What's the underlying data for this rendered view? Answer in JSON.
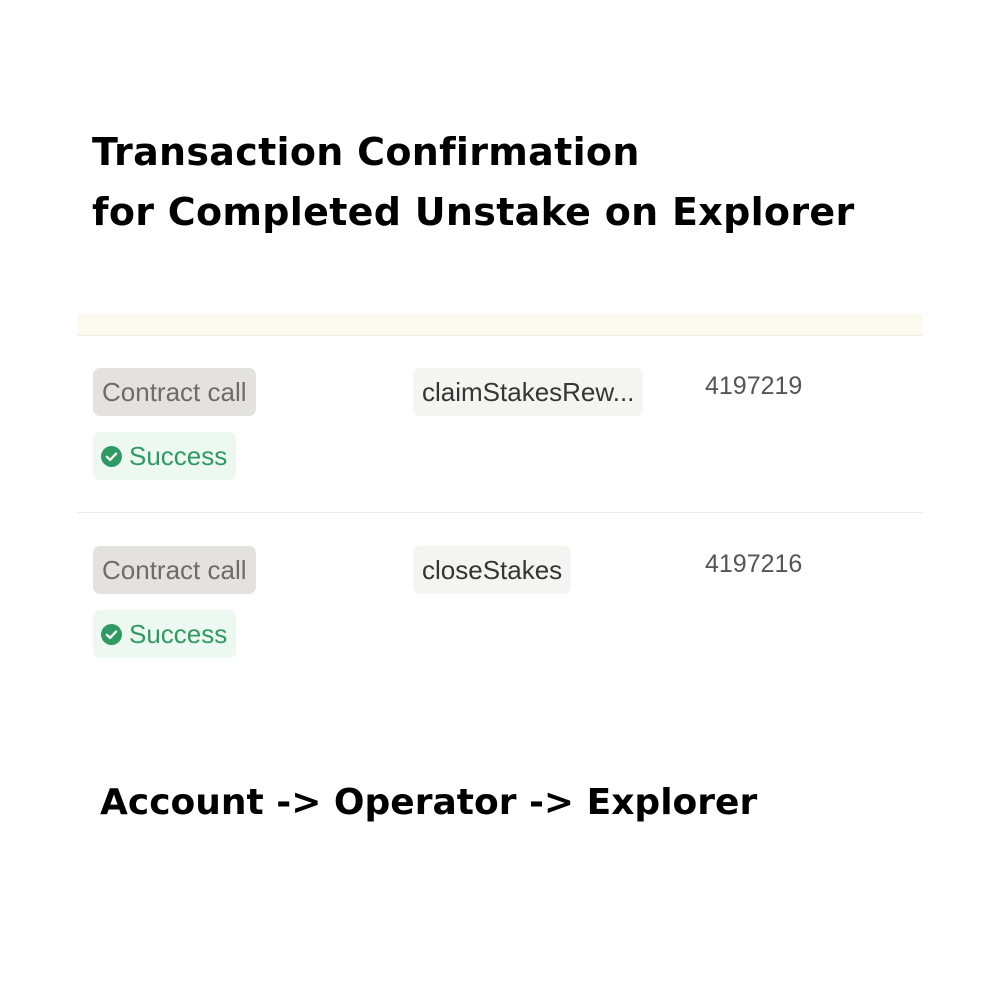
{
  "headline": {
    "line1": "Transaction Confirmation",
    "line2": "for Completed Unstake on Explorer"
  },
  "transactions": [
    {
      "type": "Contract call",
      "status": "Success",
      "status_icon": "check-circle-icon",
      "method": "claimStakesRew...",
      "block": "4197219"
    },
    {
      "type": "Contract call",
      "status": "Success",
      "status_icon": "check-circle-icon",
      "method": "closeStakes",
      "block": "4197216"
    }
  ],
  "navigation_path": "Account -> Operator -> Explorer",
  "colors": {
    "success": "#2f9a63",
    "success_bg": "#edf8f1",
    "type_badge_bg": "#e3e2de",
    "method_chip_bg": "#f4f4f3",
    "header_strip": "#fcf9ef"
  }
}
